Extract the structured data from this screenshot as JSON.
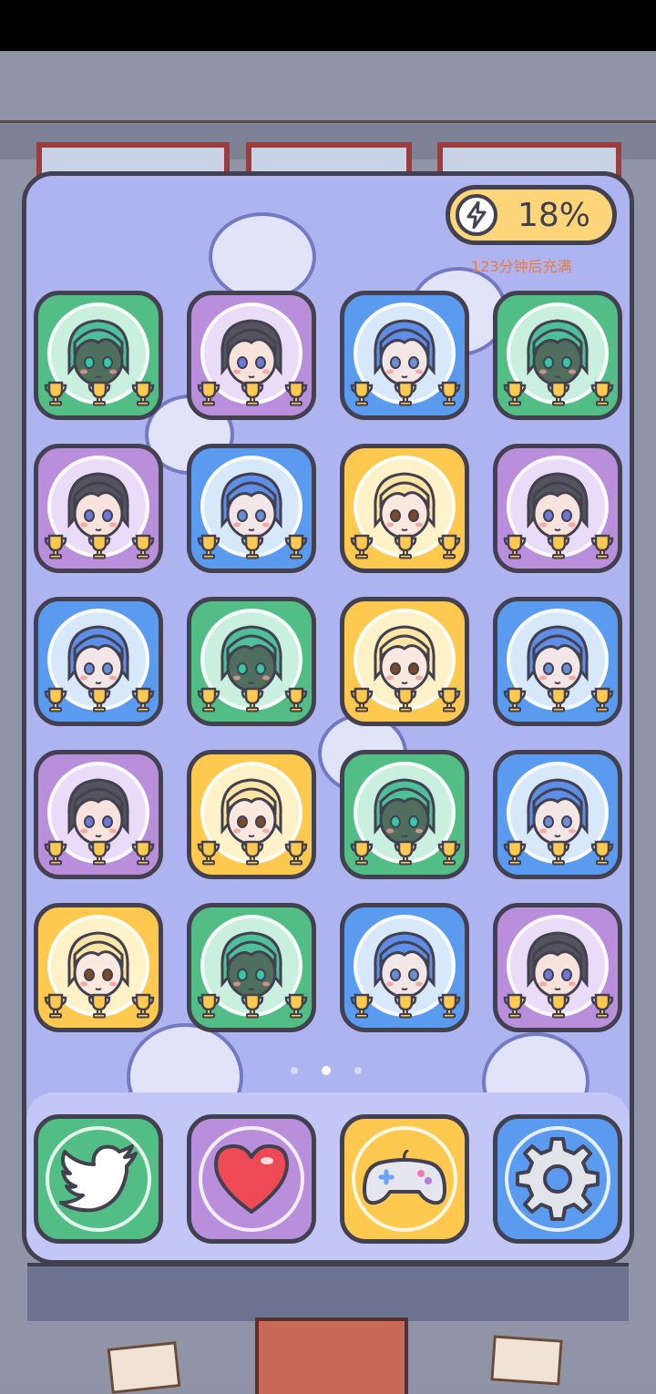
{
  "battery": {
    "percent_label": "18%",
    "percent": 18,
    "refill_text": "123分钟后充满"
  },
  "colors": {
    "green": "#52be86",
    "purple": "#b98fdb",
    "blue": "#5a9bf0",
    "yellow": "#ffc94f",
    "outline": "#43404f"
  },
  "characters": {
    "green": {
      "hair": "#4fbf9a",
      "skin": "#4f6e5e",
      "eye": "#33c7a8",
      "ring": "#c9f0de"
    },
    "purple": {
      "hair": "#55535f",
      "skin": "#f7e3db",
      "eye": "#6a7ad6",
      "ring": "#eadcf8"
    },
    "blue": {
      "hair": "#5e8ee6",
      "skin": "#f3e6e6",
      "eye": "#6a8fd6",
      "ring": "#d8e8fb"
    },
    "yellow": {
      "hair": "#fce6a6",
      "skin": "#fbe9df",
      "eye": "#7a4a2a",
      "ring": "#fff2c8"
    }
  },
  "grid": [
    [
      "green",
      "purple",
      "blue",
      "green"
    ],
    [
      "purple",
      "blue",
      "yellow",
      "purple"
    ],
    [
      "blue",
      "green",
      "yellow",
      "blue"
    ],
    [
      "purple",
      "yellow",
      "green",
      "blue"
    ],
    [
      "yellow",
      "green",
      "blue",
      "purple"
    ]
  ],
  "trophies_per_card": 3,
  "page_indicator": {
    "pages": 3,
    "current": 2
  },
  "dock": [
    {
      "name": "twitter",
      "icon": "bird-icon",
      "color": "green"
    },
    {
      "name": "favorite",
      "icon": "heart-icon",
      "color": "purple"
    },
    {
      "name": "games",
      "icon": "gamepad-icon",
      "color": "yellow"
    },
    {
      "name": "settings",
      "icon": "gear-icon",
      "color": "blue"
    }
  ]
}
